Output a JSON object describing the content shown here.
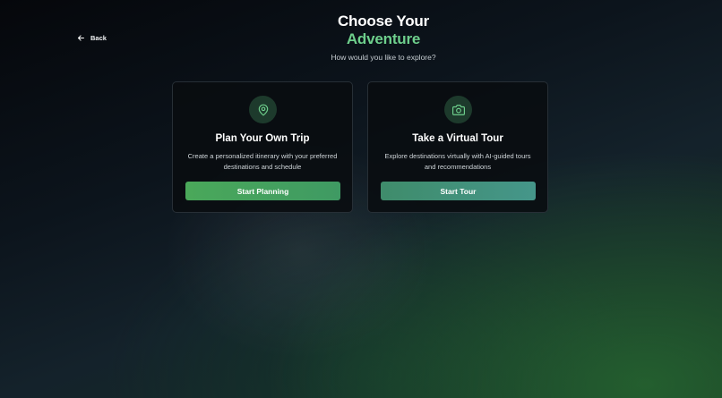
{
  "nav": {
    "back_label": "Back",
    "back_icon": "arrow-left-icon"
  },
  "header": {
    "title_line1": "Choose Your",
    "title_line2": "Adventure",
    "subtitle": "How would you like to explore?"
  },
  "options": [
    {
      "icon": "map-pin-icon",
      "title": "Plan Your Own Trip",
      "description_line1": "Create a personalized itinerary with your preferred",
      "description_line2": "destinations and schedule",
      "button_label": "Start Planning"
    },
    {
      "icon": "camera-icon",
      "title": "Take a Virtual Tour",
      "description_line1": "Explore destinations virtually with AI-guided tours",
      "description_line2": "and recommendations",
      "button_label": "Start Tour"
    }
  ],
  "colors": {
    "accent": "#6ecf8c",
    "plan_button": "#4aa85a",
    "tour_button": "#45968a",
    "card_background": "#0a0d11"
  }
}
